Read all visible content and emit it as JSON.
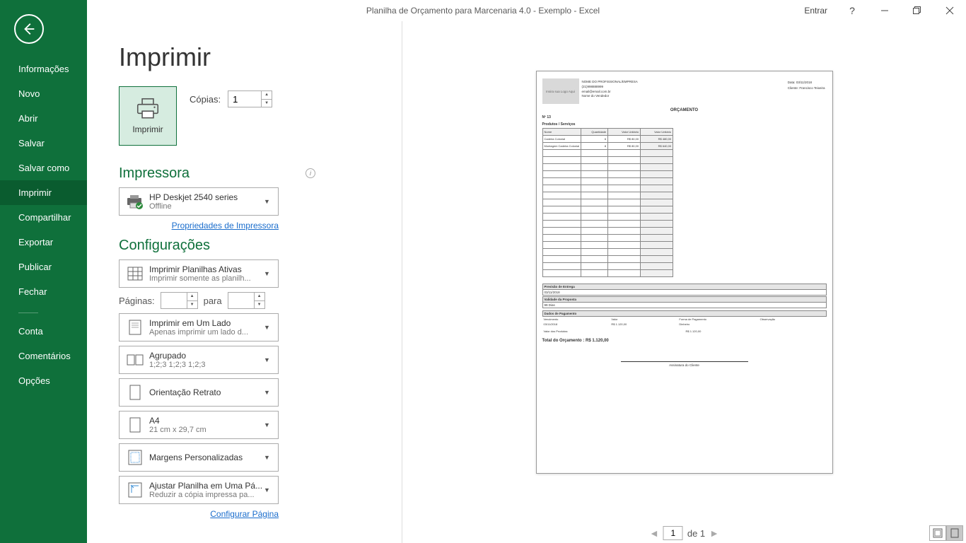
{
  "titlebar": {
    "title": "Planilha de Orçamento para Marcenaria 4.0 - Exemplo  -  Excel",
    "signin": "Entrar",
    "help": "?"
  },
  "sidebar": {
    "items": [
      {
        "key": "info",
        "label": "Informações"
      },
      {
        "key": "new",
        "label": "Novo"
      },
      {
        "key": "open",
        "label": "Abrir"
      },
      {
        "key": "save",
        "label": "Salvar"
      },
      {
        "key": "saveas",
        "label": "Salvar como"
      },
      {
        "key": "print",
        "label": "Imprimir",
        "active": true
      },
      {
        "key": "share",
        "label": "Compartilhar"
      },
      {
        "key": "export",
        "label": "Exportar"
      },
      {
        "key": "publish",
        "label": "Publicar"
      },
      {
        "key": "close",
        "label": "Fechar"
      }
    ],
    "bottom": [
      {
        "key": "account",
        "label": "Conta"
      },
      {
        "key": "feedback",
        "label": "Comentários"
      },
      {
        "key": "options",
        "label": "Opções"
      }
    ]
  },
  "page": {
    "heading": "Imprimir",
    "print_button": "Imprimir",
    "copies_label": "Cópias:",
    "copies_value": "1",
    "printer_section": "Impressora",
    "printer_name": "HP Deskjet 2540 series",
    "printer_status": "Offline",
    "printer_props": "Propriedades de Impressora",
    "settings_section": "Configurações",
    "settings": {
      "print_what": {
        "line1": "Imprimir Planilhas Ativas",
        "line2": "Imprimir somente as planilh..."
      },
      "pages_label": "Páginas:",
      "pages_to": "para",
      "sides": {
        "line1": "Imprimir em Um Lado",
        "line2": "Apenas imprimir um lado d..."
      },
      "collate": {
        "line1": "Agrupado",
        "line2": "1;2;3    1;2;3    1;2;3"
      },
      "orientation": {
        "line1": "Orientação Retrato"
      },
      "paper": {
        "line1": "A4",
        "line2": "21 cm x 29,7 cm"
      },
      "margins": {
        "line1": "Margens Personalizadas"
      },
      "scaling": {
        "line1": "Ajustar Planilha em Uma Pá...",
        "line2": "Reduzir a cópia impressa pa..."
      }
    },
    "page_setup": "Configurar Página"
  },
  "preview_footer": {
    "page_current": "1",
    "page_of": "de 1"
  },
  "preview": {
    "logo_text": "Insira sua Logo Aqui",
    "company": "NOME DO PROFISSIONAL/EMPRESA",
    "phone": "(21)998888999",
    "email": "email@email.com.br",
    "seller": "Nome do Vendedor",
    "date_label": "Data:",
    "date": "03/11/2018",
    "client_label": "Cliente:",
    "client": "Francisco Teixeira",
    "title": "ORÇAMENTO",
    "number": "Nº 13",
    "products_label": "Produtos / Serviços",
    "table_headers": [
      "Nome",
      "Quantidade",
      "Valor Unitário",
      "Valor Unitário"
    ],
    "rows": [
      {
        "name": "Cadeira Colonial",
        "qty": "6",
        "unit": "R$ 80,00",
        "tot": "R$ 480,00"
      },
      {
        "name": "Montagem Cadeira Colonial",
        "qty": "8",
        "unit": "R$ 80,00",
        "tot": "R$ 640,00"
      }
    ],
    "delivery_label": "Previsão de Entrega",
    "delivery_value": "03/11/2018",
    "proposal_label": "Validade da Proposta",
    "proposal_value": "99 Dias",
    "payment_label": "Dados de Pagamento",
    "payment_cols": [
      "Vencimento",
      "Valor",
      "Forma de Pagamento",
      "Observação"
    ],
    "payment_row": [
      "03/11/2018",
      "R$ 1.120,00",
      "Dinheiro",
      ""
    ],
    "products_value_label": "Valor dos Produtos:",
    "products_value": "R$ 1.120,00",
    "total_label": "Total do Orçamento : R$ 1.120,00",
    "signature": "Assinatura do Cliente"
  }
}
